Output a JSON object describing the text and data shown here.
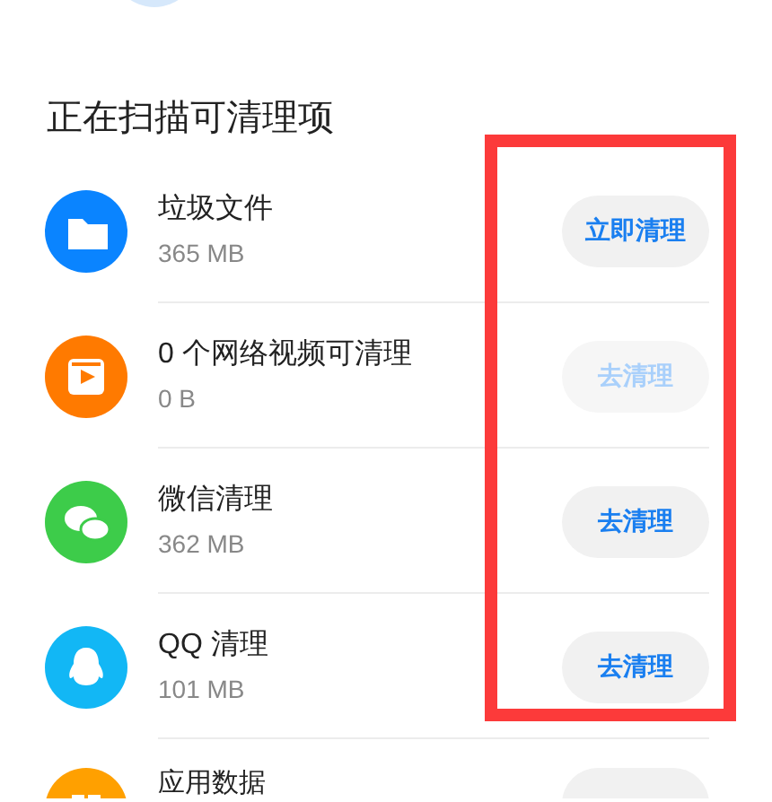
{
  "section_title": "正在扫描可清理项",
  "items": [
    {
      "kind": "folder",
      "name": "垃圾文件",
      "size": "365 MB",
      "button": {
        "label": "立即清理",
        "disabled": false
      }
    },
    {
      "kind": "video",
      "name": "0 个网络视频可清理",
      "size": "0 B",
      "button": {
        "label": "去清理",
        "disabled": true
      }
    },
    {
      "kind": "chat",
      "name": "微信清理",
      "size": "362 MB",
      "button": {
        "label": "去清理",
        "disabled": false
      }
    },
    {
      "kind": "penguin",
      "name": "QQ 清理",
      "size": "101 MB",
      "button": {
        "label": "去清理",
        "disabled": false
      }
    },
    {
      "kind": "app",
      "name": "应用数据"
    }
  ]
}
